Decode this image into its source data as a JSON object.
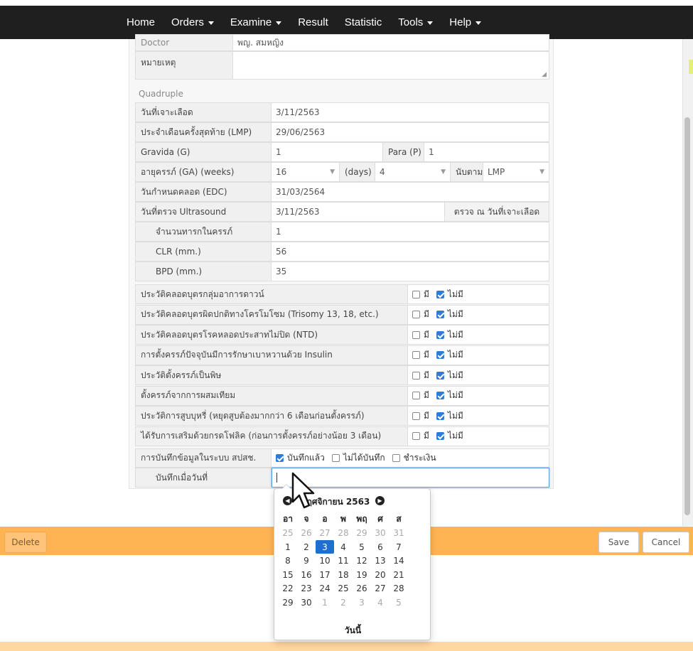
{
  "nav": {
    "items": [
      {
        "label": "Home",
        "dropdown": false
      },
      {
        "label": "Orders",
        "dropdown": true
      },
      {
        "label": "Examine",
        "dropdown": true
      },
      {
        "label": "Result",
        "dropdown": false
      },
      {
        "label": "Statistic",
        "dropdown": false
      },
      {
        "label": "Tools",
        "dropdown": true
      },
      {
        "label": "Help",
        "dropdown": true
      }
    ]
  },
  "top": {
    "doctor_label": "Doctor",
    "doctor_value": "พญ. สมหญิง",
    "note_label": "หมายเหตุ",
    "note_value": ""
  },
  "quad": {
    "title": "Quadruple",
    "blood_date_label": "วันที่เจาะเลือด",
    "blood_date_value": "3/11/2563",
    "lmp_label": "ประจำเดือนครั้งสุดท้าย (LMP)",
    "lmp_value": "29/06/2563",
    "gravida_label": "Gravida (G)",
    "gravida_value": "1",
    "para_label": "Para (P)",
    "para_value": "1",
    "ga_label": "อายุครรภ์ (GA) (weeks)",
    "ga_weeks": "16",
    "ga_days_label": "(days)",
    "ga_days": "4",
    "count_by_label": "นับตาม",
    "count_by_value": "LMP",
    "edc_label": "วันกำหนดคลอด (EDC)",
    "edc_value": "31/03/2564",
    "us_label": "วันที่ตรวจ Ultrasound",
    "us_value": "3/11/2563",
    "us_btn": "ตรวจ ณ วันที่เจาะเลือด",
    "fetus_label": "จำนวนทารกในครรภ์",
    "fetus_value": "1",
    "crl_label": "CLR (mm.)",
    "crl_value": "56",
    "bpd_label": "BPD (mm.)",
    "bpd_value": "35"
  },
  "history": {
    "yes_label": "มี",
    "no_label": "ไม่มี",
    "items": [
      {
        "label": "ประวัติคลอดบุตรกลุ่มอาการดาวน์",
        "yes": false,
        "no": true
      },
      {
        "label": "ประวัติคลอดบุตรผิดปกติทางโครโมโซม (Trisomy 13, 18, etc.)",
        "yes": false,
        "no": true
      },
      {
        "label": "ประวัติคลอดบุตรโรคหลอดประสาทไม่ปิด (NTD)",
        "yes": false,
        "no": true
      },
      {
        "label": "การตั้งครรภ์ปัจจุบันมีการรักษาเบาหวานด้วย Insulin",
        "yes": false,
        "no": true
      },
      {
        "label": "ประวัติตั้งครรภ์เป็นพิษ",
        "yes": false,
        "no": true
      },
      {
        "label": "ตั้งครรภ์จากการผสมเทียม",
        "yes": false,
        "no": true
      },
      {
        "label": "ประวัติการสูบบุหรี่ (หยุดสูบต้องมากกว่า 6 เดือนก่อนตั้งครรภ์)",
        "yes": false,
        "no": true
      },
      {
        "label": "ได้รับการเสริมด้วยกรดโฟลิค (ก่อนการตั้งครรภ์อย่างน้อย 3 เดือน)",
        "yes": false,
        "no": true
      }
    ]
  },
  "record": {
    "label": "การบันทึกข้อมูลในระบบ สปสช.",
    "opt1": "บันทึกแล้ว",
    "opt1_checked": true,
    "opt2": "ไม่ได้บันทึก",
    "opt2_checked": false,
    "opt3": "ชำระเงิน",
    "opt3_checked": false,
    "date_label": "บันทึกเมื่อวันที่",
    "date_value": ""
  },
  "datepicker": {
    "title": "พฤศจิกายน 2563",
    "dow": [
      "อา",
      "จ",
      "อ",
      "พ",
      "พฤ",
      "ศ",
      "ส"
    ],
    "weeks": [
      [
        "25",
        "26",
        "27",
        "28",
        "29",
        "30",
        "31"
      ],
      [
        "1",
        "2",
        "3",
        "4",
        "5",
        "6",
        "7"
      ],
      [
        "8",
        "9",
        "10",
        "11",
        "12",
        "13",
        "14"
      ],
      [
        "15",
        "16",
        "17",
        "18",
        "19",
        "20",
        "21"
      ],
      [
        "22",
        "23",
        "24",
        "25",
        "26",
        "27",
        "28"
      ],
      [
        "29",
        "30",
        "1",
        "2",
        "3",
        "4",
        "5"
      ]
    ],
    "muted_first_row": true,
    "muted_last_from": 2,
    "selected": "3",
    "today_label": "วันนี้"
  },
  "actions": {
    "delete_label": "Delete",
    "save_label": "Save",
    "cancel_label": "Cancel"
  }
}
